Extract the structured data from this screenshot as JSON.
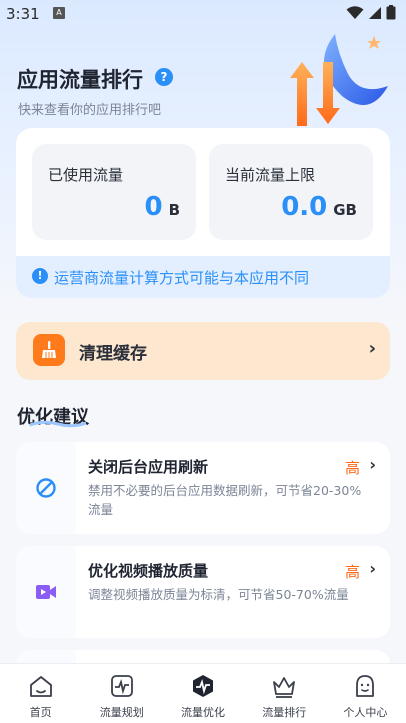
{
  "status_bar": {
    "time": "3:31",
    "notif_letter": "A"
  },
  "header": {
    "title": "应用流量排行",
    "subtitle": "快来查看你的应用排行吧"
  },
  "usage": {
    "used_label": "已使用流量",
    "used_value": "0",
    "used_unit": "B",
    "limit_label": "当前流量上限",
    "limit_value": "0.0",
    "limit_unit": "GB",
    "notice": "运营商流量计算方式可能与本应用不同"
  },
  "clean_cache": {
    "label": "清理缓存"
  },
  "section": {
    "title": "优化建议"
  },
  "suggestions": [
    {
      "title": "关闭后台应用刷新",
      "priority": "高",
      "desc": "禁用不必要的后台应用数据刷新，可节省20-30%流量"
    },
    {
      "title": "优化视频播放质量",
      "priority": "高",
      "desc": "调整视频播放质量为标清，可节省50-70%流量"
    }
  ],
  "nav": [
    {
      "label": "首页",
      "icon": "home-icon"
    },
    {
      "label": "流量规划",
      "icon": "plan-icon"
    },
    {
      "label": "流量优化",
      "icon": "optimize-icon"
    },
    {
      "label": "流量排行",
      "icon": "ranking-icon"
    },
    {
      "label": "个人中心",
      "icon": "profile-icon"
    }
  ],
  "colors": {
    "accent": "#2b8ff8",
    "priority_high": "#ff6a1a",
    "clean_bg": "#fde8cf"
  }
}
